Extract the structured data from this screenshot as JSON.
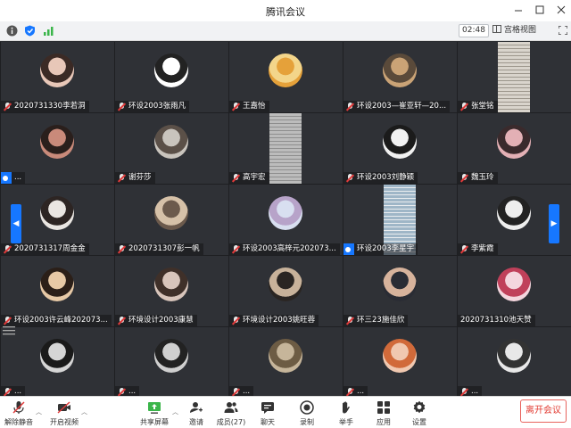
{
  "window": {
    "title": "腾讯会议",
    "controls": [
      "minimize",
      "maximize",
      "close"
    ]
  },
  "infobar": {
    "timer": "02:48",
    "view_label": "宫格视图"
  },
  "colors": {
    "accent": "#1677ff",
    "mute_red": "#e03a3a",
    "leave_red": "#e23b32",
    "tile_bg": "#2f3136",
    "signal_green": "#3ab54a"
  },
  "participants": [
    {
      "name": "2020731330李若洞",
      "muted": true,
      "avatar_colors": [
        "#e8c7b8",
        "#3b2a25"
      ]
    },
    {
      "name": "环设2003张雨凡",
      "muted": true,
      "avatar_colors": [
        "#ffffff",
        "#222222"
      ]
    },
    {
      "name": "王嘉怡",
      "muted": true,
      "avatar_colors": [
        "#e5a13a",
        "#f3d58a"
      ]
    },
    {
      "name": "环设2003—崔亚轩—20...",
      "muted": true,
      "avatar_colors": [
        "#caa376",
        "#5a4a3a"
      ]
    },
    {
      "name": "张堂铭",
      "muted": true,
      "screen": true,
      "avatar_colors": [
        "#d9d4cc",
        "#9c968c"
      ]
    },
    {
      "name": "...",
      "muted": false,
      "host": true,
      "avatar_colors": [
        "#c98a7a",
        "#2a1f1c"
      ]
    },
    {
      "name": "谢芬莎",
      "muted": true,
      "avatar_colors": [
        "#c9c4bd",
        "#5b5048"
      ]
    },
    {
      "name": "高宇宏",
      "muted": true,
      "screen": true,
      "avatar_colors": [
        "#bcbcbc",
        "#8e8e8e"
      ]
    },
    {
      "name": "环设2003刘静颖",
      "muted": true,
      "avatar_colors": [
        "#f1f1f1",
        "#1b1b1b"
      ]
    },
    {
      "name": "魏玉玲",
      "muted": true,
      "avatar_colors": [
        "#e3b0b5",
        "#3a2a2c"
      ]
    },
    {
      "name": "2020731317周金金",
      "muted": true,
      "avatar_colors": [
        "#eae6e2",
        "#2d2523"
      ]
    },
    {
      "name": "2020731307彭一帆",
      "muted": true,
      "avatar_colors": [
        "#6c5a4c",
        "#d6c1a8"
      ]
    },
    {
      "name": "环设2003高梓元202073...",
      "muted": true,
      "avatar_colors": [
        "#d8dff0",
        "#b7a3c9"
      ]
    },
    {
      "name": "环设2003李星宇",
      "muted": false,
      "host": true,
      "screen": true,
      "avatar_colors": [
        "#9fb6c7",
        "#e9ecef"
      ]
    },
    {
      "name": "李紫霞",
      "muted": true,
      "avatar_colors": [
        "#eeeeee",
        "#222222"
      ]
    },
    {
      "name": "环设2003许云峰202073...",
      "muted": true,
      "avatar_colors": [
        "#e7c9a6",
        "#2b1f18"
      ]
    },
    {
      "name": "环境设计2003康慧",
      "muted": true,
      "avatar_colors": [
        "#d8c5bb",
        "#3f3029"
      ]
    },
    {
      "name": "环境设计2003姚旺蓉",
      "muted": true,
      "avatar_colors": [
        "#2a2522",
        "#c8b29a"
      ]
    },
    {
      "name": "环三23施佳欣",
      "muted": true,
      "avatar_colors": [
        "#2a2c34",
        "#d7b39c"
      ]
    },
    {
      "name": "2020731310池天赞",
      "muted": false,
      "avatar_colors": [
        "#f4d6de",
        "#c0405a"
      ]
    },
    {
      "name": "...",
      "muted": true,
      "avatar_colors": [
        "#d5d5d5",
        "#1a1a1a"
      ]
    },
    {
      "name": "...",
      "muted": true,
      "avatar_colors": [
        "#cfcfcf",
        "#222222"
      ]
    },
    {
      "name": "...",
      "muted": true,
      "avatar_colors": [
        "#c6b59a",
        "#6d5c44"
      ]
    },
    {
      "name": "...",
      "muted": true,
      "avatar_colors": [
        "#f0c8b0",
        "#d16a3a"
      ]
    },
    {
      "name": "...",
      "muted": true,
      "avatar_colors": [
        "#e8e8e8",
        "#333333"
      ]
    }
  ],
  "toolbar": {
    "mute": {
      "label": "解除静音",
      "icon": "mic-muted-icon"
    },
    "video": {
      "label": "开启视频",
      "icon": "camera-off-icon"
    },
    "share": {
      "label": "共享屏幕",
      "icon": "share-screen-icon"
    },
    "invite": {
      "label": "邀请",
      "icon": "invite-icon"
    },
    "members": {
      "label": "成员(27)",
      "icon": "members-icon"
    },
    "chat": {
      "label": "聊天",
      "icon": "chat-icon"
    },
    "record": {
      "label": "录制",
      "icon": "record-icon"
    },
    "hand": {
      "label": "举手",
      "icon": "hand-icon"
    },
    "apps": {
      "label": "应用",
      "icon": "apps-icon"
    },
    "settings": {
      "label": "设置",
      "icon": "settings-icon"
    },
    "leave": {
      "label": "离开会议"
    }
  }
}
